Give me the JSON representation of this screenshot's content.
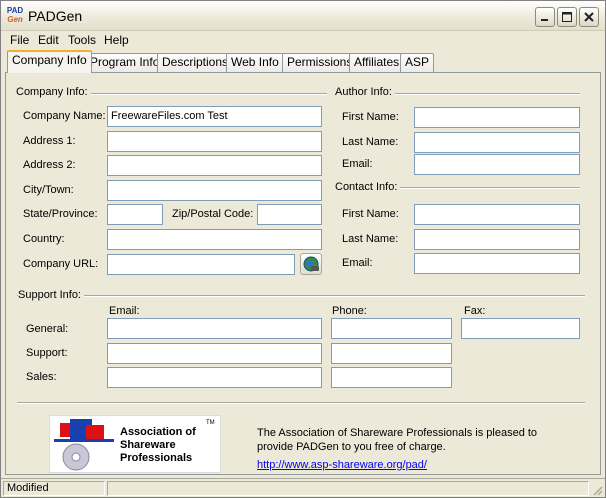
{
  "window": {
    "title": "PADGen",
    "icon_label_top": "PAD",
    "icon_label_bottom": "Gen"
  },
  "menu": [
    "File",
    "Edit",
    "Tools",
    "Help"
  ],
  "tabs": [
    "Company Info",
    "Program Info",
    "Descriptions",
    "Web Info",
    "Permissions",
    "Affiliates",
    "ASP"
  ],
  "company": {
    "group_label": "Company Info:",
    "name_label": "Company Name:",
    "name_value": "FreewareFiles.com Test",
    "address1_label": "Address 1:",
    "address1_value": "",
    "address2_label": "Address 2:",
    "address2_value": "",
    "city_label": "City/Town:",
    "city_value": "",
    "state_label": "State/Province:",
    "state_value": "",
    "zip_label": "Zip/Postal Code:",
    "zip_value": "",
    "country_label": "Country:",
    "country_value": "",
    "url_label": "Company URL:",
    "url_value": ""
  },
  "author": {
    "group_label": "Author Info:",
    "first_label": "First Name:",
    "last_label": "Last Name:",
    "email_label": "Email:"
  },
  "contact": {
    "group_label": "Contact Info:",
    "first_label": "First Name:",
    "last_label": "Last Name:",
    "email_label": "Email:"
  },
  "support": {
    "group_label": "Support Info:",
    "email_header": "Email:",
    "phone_header": "Phone:",
    "fax_header": "Fax:",
    "rows": [
      "General:",
      "Support:",
      "Sales:"
    ]
  },
  "asp": {
    "logo_lines": [
      "Association of",
      "Shareware",
      "Professionals"
    ],
    "logo_tm": "TM",
    "message": "The Association of Shareware Professionals is pleased to provide PADGen to you free of charge.",
    "link": "http://www.asp-shareware.org/pad/"
  },
  "status": {
    "text": "Modified"
  },
  "colors": {
    "accent_tab": "#f0b030",
    "input_border": "#7f9db9",
    "link": "#0000ee"
  }
}
